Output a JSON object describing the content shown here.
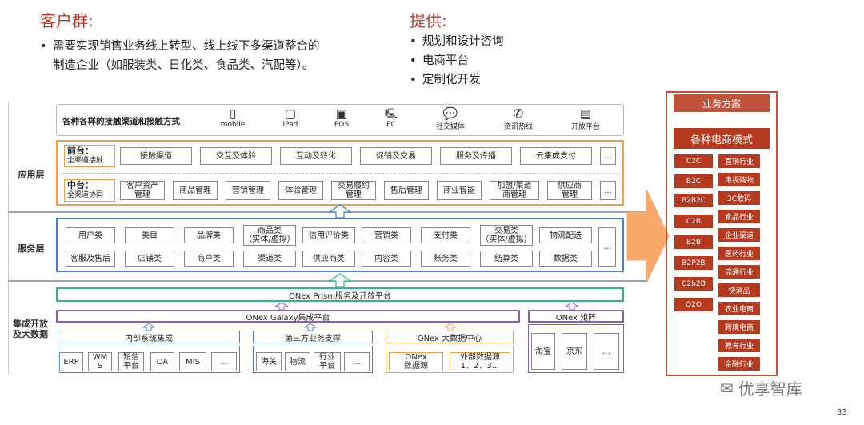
{
  "left_heading": "客户群:",
  "left_bullets": [
    "需要实现销售业务线上转型、线上线下多渠道整合的",
    "制造企业（如服装类、日化类、食品类、汽配等）。"
  ],
  "right_heading": "提供:",
  "right_bullets": [
    "规划和设计咨询",
    "电商平台",
    "定制化开发"
  ],
  "layers": {
    "app": "应用层",
    "service": "服务层",
    "integration": "集成开放\n及大数据"
  },
  "channels": {
    "title": "各种各样的接触渠道和接触方式",
    "items": [
      {
        "label": "mobile",
        "icon": "mobile-icon"
      },
      {
        "label": "iPad",
        "icon": "ipad-icon"
      },
      {
        "label": "POS",
        "icon": "pos-icon"
      },
      {
        "label": "PC",
        "icon": "pc-icon"
      },
      {
        "label": "社交媒体",
        "icon": "chat-icon"
      },
      {
        "label": "资讯热线",
        "icon": "phone-icon"
      },
      {
        "label": "开放平台",
        "icon": "platform-icon"
      }
    ]
  },
  "front": {
    "label1": "前台：",
    "label2": "全渠道接触",
    "items": [
      "接触渠道",
      "交互及体验",
      "互动及转化",
      "促销及交易",
      "服务及传播",
      "云集成支付",
      "..."
    ]
  },
  "middle": {
    "label1": "中台：",
    "label2": "全渠道协同",
    "items": [
      "客户资产\n管理",
      "商品管理",
      "营销管理",
      "体验管理",
      "交易履约\n管理",
      "售后管理",
      "商业智能",
      "加盟/渠道\n商管理",
      "供应商\n管理",
      "..."
    ]
  },
  "service_row1": [
    "用户类",
    "类目",
    "品牌类",
    "商品类\n（实体/虚拟）",
    "信用评价类",
    "营销类",
    "支付类",
    "交易类\n（实体/虚拟）",
    "物流配送"
  ],
  "service_row2": [
    "客服及售后",
    "店铺类",
    "商户类",
    "渠道类",
    "供应商类",
    "内容类",
    "账务类",
    "结算类",
    "数据类"
  ],
  "service_more": "...",
  "prism": "ONex Prism服务及开放平台",
  "galaxy": "ONex Galaxy集成平台",
  "matrix": "ONex 矩阵",
  "internal": {
    "title": "内部系统集成",
    "items": [
      "ERP",
      "WM\nS",
      "短信\n平台",
      "OA",
      "MIS",
      "..."
    ]
  },
  "third": {
    "title": "第三方业务支撑",
    "items": [
      "海关",
      "物流",
      "行业\n平台",
      "..."
    ]
  },
  "bigdata": {
    "title": "ONex 大数据中心",
    "items": [
      "ONex\n数据源",
      "外部数据源\n1、2、3..."
    ]
  },
  "matrix_items": [
    "淘宝",
    "京东",
    "..."
  ],
  "biz": {
    "title": "业务方案",
    "subtitle": "各种电商模式",
    "models": [
      "C2C",
      "B2C",
      "B2B2C",
      "C2B",
      "B2B",
      "B2P2B",
      "C2b2B",
      "O2O"
    ],
    "industries": [
      "直销行业",
      "电视购物",
      "3C数码",
      "食品行业",
      "企业渠道",
      "医药行业",
      "流通行业",
      "快消品",
      "农业电商",
      "跨境电商",
      "教育行业",
      "金融行业"
    ]
  },
  "watermark": "优享智库",
  "page_number": "33"
}
